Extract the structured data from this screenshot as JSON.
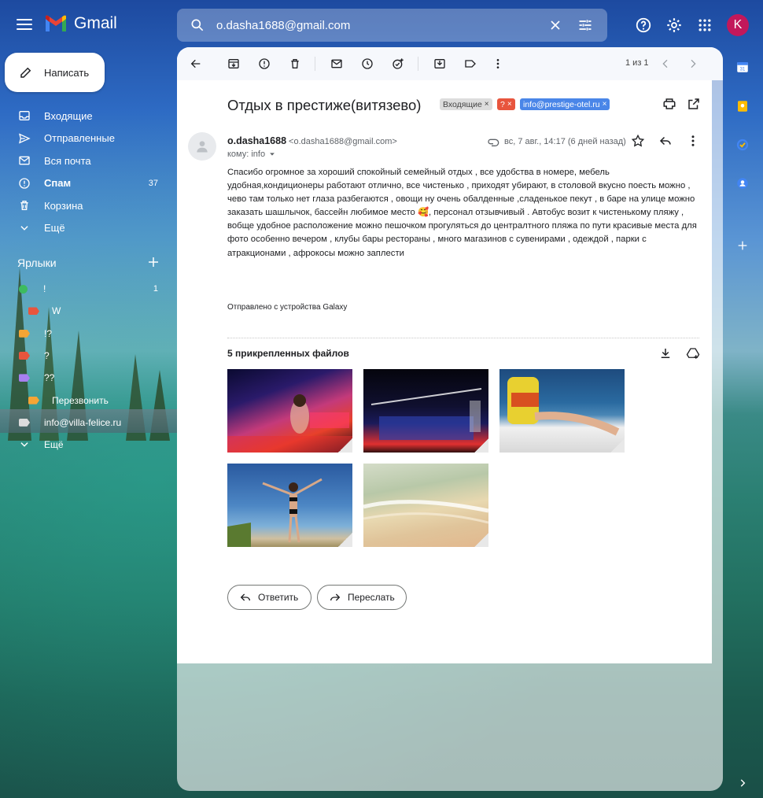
{
  "app": {
    "name": "Gmail"
  },
  "search": {
    "value": "o.dasha1688@gmail.com"
  },
  "account": {
    "initial": "K",
    "color": "#c2185b"
  },
  "compose": {
    "label": "Написать"
  },
  "nav": [
    {
      "label": "Входящие",
      "icon": "inbox-icon",
      "count": ""
    },
    {
      "label": "Отправленные",
      "icon": "send-icon",
      "count": ""
    },
    {
      "label": "Вся почта",
      "icon": "mail-icon",
      "count": ""
    },
    {
      "label": "Спам",
      "icon": "report-icon",
      "count": "37"
    },
    {
      "label": "Корзина",
      "icon": "trash-icon",
      "count": ""
    },
    {
      "label": "Ещё",
      "icon": "chevron-down-icon",
      "count": ""
    }
  ],
  "labels": {
    "header": "Ярлыки",
    "items": [
      {
        "label": "!",
        "color": "#3dbb5f",
        "count": "1",
        "indent": 0
      },
      {
        "label": "W",
        "color": "#e8553d",
        "count": "",
        "indent": 1
      },
      {
        "label": "!?",
        "color": "#f4a535",
        "count": "",
        "indent": 0
      },
      {
        "label": "?",
        "color": "#e8553d",
        "count": "",
        "indent": 0
      },
      {
        "label": "??",
        "color": "#a77ff0",
        "count": "",
        "indent": 0
      },
      {
        "label": "Перезвонить",
        "color": "#f4a535",
        "count": "",
        "indent": 1
      },
      {
        "label": "info@villa-felice.ru",
        "color": "#dcdcdc",
        "count": "",
        "indent": 0
      },
      {
        "label": "Ещё",
        "color": "",
        "count": "",
        "indent": 0
      }
    ]
  },
  "pager": {
    "text": "1 из 1"
  },
  "email": {
    "subject": "Отдых в престиже(витязево)",
    "chips": [
      {
        "text": "Входящие",
        "bg": "#dddddd",
        "fg": "#444444"
      },
      {
        "text": "?",
        "bg": "#e8553d",
        "fg": "#ffffff"
      },
      {
        "text": "info@prestige-otel.ru",
        "bg": "#4a86e8",
        "fg": "#ffffff"
      }
    ],
    "chip_close": "×",
    "sender_name": "o.dasha1688",
    "sender_email": "<o.dasha1688@gmail.com>",
    "to": "кому: info",
    "date": "вс, 7 авг., 14:17 (6 дней назад)",
    "body": "Спасибо огромное за хороший спокойный семейный отдых , все удобства в номере, мебель удобная,кондиционеры работают  отлично, все чистенько , приходят убирают, в столовой вкусно поесть можно , чево там только нет глаза разбегаются , овощи ну очень обалденные ,сладенькое пекут , в баре на улице можно заказать шашлычок, бассейн любимое место 🥰, персонал отзывчивый . Автобус возит к чистенькому пляжу , вобще удобное расположение можно пешочком прогуляться до централтного пляжа по пути красивые места для фото особенно вечером , клубы бары рестораны , много магазинов с сувенирами , одеждой , парки с атракционами , афрокосы можно заплести",
    "signature": "Отправлено с устройства Galaxy"
  },
  "attachments": {
    "title": "5 прикрепленных файлов",
    "items": [
      {
        "name": "photo-night-club"
      },
      {
        "name": "photo-night-terrace"
      },
      {
        "name": "photo-lifejacket-boat"
      },
      {
        "name": "photo-beach-pose"
      },
      {
        "name": "photo-sand-shore"
      }
    ]
  },
  "actions": {
    "reply": "Ответить",
    "forward": "Переслать"
  }
}
